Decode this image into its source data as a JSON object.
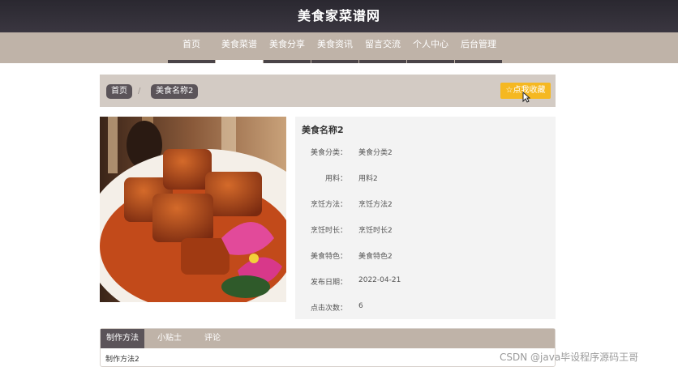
{
  "site": {
    "title": "美食家菜谱网"
  },
  "nav": {
    "items": [
      {
        "label": "首页"
      },
      {
        "label": "美食菜谱",
        "active": true
      },
      {
        "label": "美食分享"
      },
      {
        "label": "美食资讯"
      },
      {
        "label": "留言交流"
      },
      {
        "label": "个人中心"
      },
      {
        "label": "后台管理"
      }
    ]
  },
  "breadcrumb": {
    "home": "首页",
    "separator": "/",
    "current": "美食名称2"
  },
  "favorite": {
    "label": "☆点我收藏"
  },
  "detail": {
    "title": "美食名称2",
    "fields": [
      {
        "label": "美食分类：",
        "value": "美食分类2"
      },
      {
        "label": "用料：",
        "value": "用料2"
      },
      {
        "label": "烹饪方法：",
        "value": "烹饪方法2"
      },
      {
        "label": "烹饪时长：",
        "value": "烹饪时长2"
      },
      {
        "label": "美食特色：",
        "value": "美食特色2"
      },
      {
        "label": "发布日期：",
        "value": "2022-04-21"
      },
      {
        "label": "点击次数：",
        "value": "6"
      }
    ]
  },
  "tabs": {
    "items": [
      {
        "label": "制作方法",
        "active": true
      },
      {
        "label": "小贴士"
      },
      {
        "label": "评论"
      }
    ],
    "content": "制作方法2"
  },
  "watermark": "CSDN @java毕设程序源码王哥",
  "colors": {
    "header_bg": "#2a2830",
    "nav_bg": "#bfb3a8",
    "active_dark": "#5b5459",
    "favorite_yellow": "#f5b821",
    "panel_bg": "#f3f3f3"
  }
}
